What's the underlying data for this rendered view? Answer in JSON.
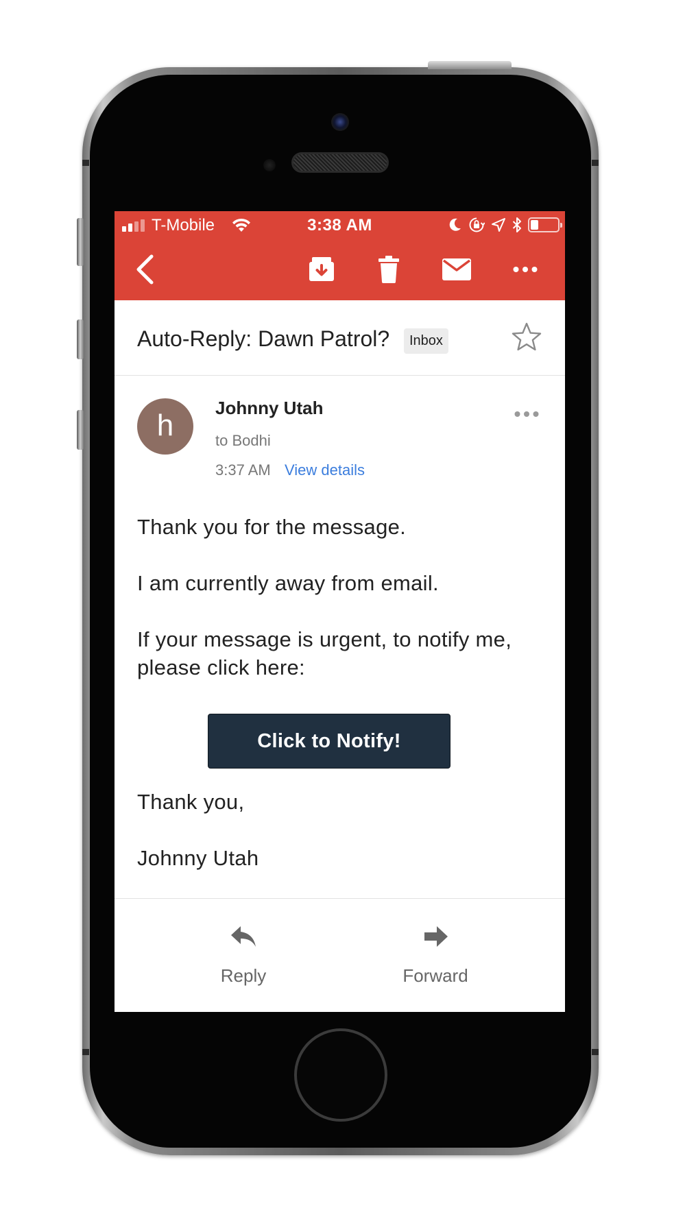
{
  "status_bar": {
    "carrier": "T-Mobile",
    "time": "3:38 AM",
    "battery_level": 0.3
  },
  "toolbar": {
    "icons": [
      "back-arrow-icon",
      "archive-icon",
      "trash-icon",
      "mail-icon",
      "more-horizontal-icon"
    ],
    "background": "#db4437"
  },
  "email": {
    "subject": "Auto-Reply: Dawn Patrol?",
    "label": "Inbox",
    "sender_initial": "h",
    "sender_name": "Johnny Utah",
    "recipient": "to Bodhi",
    "time": "3:37 AM",
    "view_details": "View details",
    "avatar_color": "#8d6e63",
    "body": {
      "line1": "Thank you for the message.",
      "line2": "I am currently away from email.",
      "line3": "If your message is urgent, to notify me, please click here:",
      "button": "Click to Notify!",
      "line4": "Thank you,",
      "line5": "Johnny Utah"
    }
  },
  "actions": {
    "reply": "Reply",
    "forward": "Forward"
  },
  "colors": {
    "accent": "#db4437",
    "link": "#3b7ddd",
    "button": "#203040"
  }
}
